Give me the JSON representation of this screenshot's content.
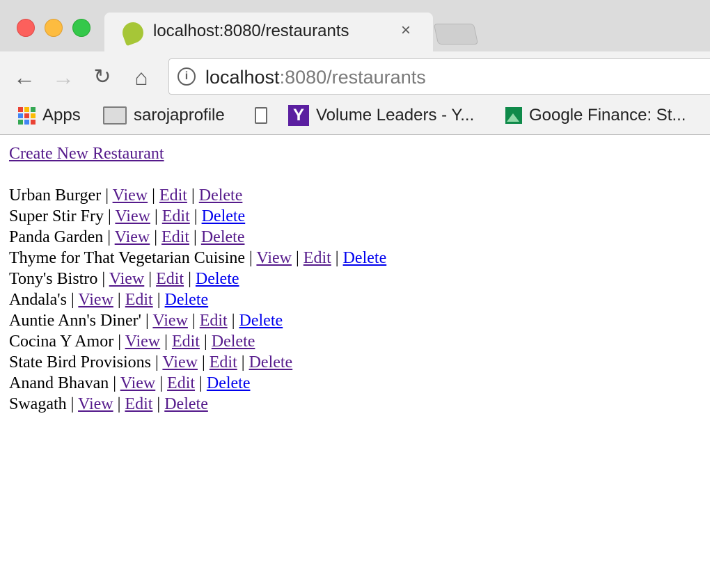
{
  "browser": {
    "tab_title": "localhost:8080/restaurants",
    "tab_close": "×",
    "url_host": "localhost",
    "url_rest": ":8080/restaurants",
    "nav": {
      "back": "←",
      "forward": "→",
      "reload": "↻",
      "home": "⌂"
    },
    "info": "i",
    "bookmarks": {
      "apps": "Apps",
      "saroja": "sarojaprofile",
      "volume": "Volume Leaders - Y...",
      "finance": "Google Finance: St..."
    },
    "yahoo_letter": "Y"
  },
  "page": {
    "create_link": "Create New Restaurant ",
    "separator": "|",
    "view_label": "View",
    "edit_label": "Edit",
    "delete_label": "Delete",
    "restaurants": [
      "Urban Burger",
      "Super Stir Fry",
      "Panda Garden",
      "Thyme for That Vegetarian Cuisine",
      "Tony's Bistro",
      "Andala's",
      "Auntie Ann's Diner'",
      "Cocina Y Amor",
      "State Bird Provisions",
      "Anand Bhavan",
      "Swagath"
    ]
  },
  "colors": {
    "visited_link": "#551a8b",
    "unvisited_link": "#0000ee"
  }
}
